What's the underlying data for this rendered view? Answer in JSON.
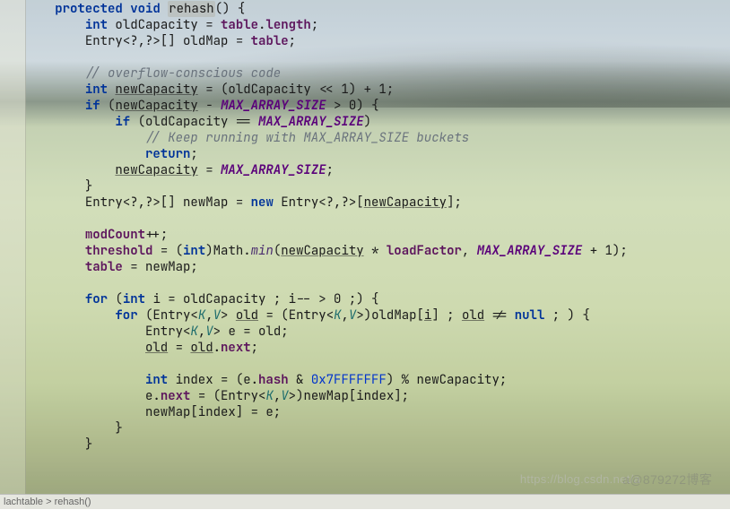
{
  "code": {
    "method_modifier": "protected",
    "method_return": "void",
    "method_name": "rehash",
    "l1_kw_int": "int",
    "l1_var": "oldCapacity",
    "l1_field_table": "table",
    "l1_field_length": "length",
    "l2_type": "Entry",
    "l2_generics": "<?,?>[]",
    "l2_var": "oldMap",
    "l2_assign": "table",
    "c1": "// overflow-conscious code",
    "l3_kw_int": "int",
    "l3_var": "newCapacity",
    "l3_expr_left": "(oldCapacity << 1) + 1",
    "l4_kw_if": "if",
    "l4_cond_left": "newCapacity",
    "l4_minus": "-",
    "l4_const": "MAX_ARRAY_SIZE",
    "l4_cmp": "> 0) {",
    "l5_kw_if": "if",
    "l5_cond": "(oldCapacity ==",
    "l5_const": "MAX_ARRAY_SIZE",
    "l5_close": ")",
    "c2": "// Keep running with MAX_ARRAY_SIZE buckets",
    "l6_kw_return": "return",
    "l7_var": "newCapacity",
    "l7_const": "MAX_ARRAY_SIZE",
    "l8_type": "Entry",
    "l8_gen": "<?,?>[]",
    "l8_var": "newMap",
    "l8_kw_new": "new",
    "l8_ctor": "Entry",
    "l8_ctor_gen": "<?,?>",
    "l8_dim_var": "newCapacity",
    "l9_field": "modCount",
    "l9_op": "++",
    "l10_field": "threshold",
    "l10_cast": "(",
    "l10_cast_type": "int",
    "l10_cast_close": ")",
    "l10_class": "Math",
    "l10_method": "min",
    "l10_arg1": "newCapacity",
    "l10_mul": "*",
    "l10_arg2": "loadFactor",
    "l10_const": "MAX_ARRAY_SIZE",
    "l10_plus1": "+ 1)",
    "l11_field": "table",
    "l11_var": "newMap",
    "l12_kw_for": "for",
    "l12_kw_int": "int",
    "l12_var": "i",
    "l12_init": "= oldCapacity ; i-- > 0 ;) {",
    "l13_kw_for": "for",
    "l13_type": "Entry",
    "l13_gen_o": "<",
    "l13_K": "K",
    "l13_comma": ",",
    "l13_V": "V",
    "l13_gen_c": ">",
    "l13_var_old": "old",
    "l13_eq": "=",
    "l13_cast_o": "(",
    "l13_cast_type": "Entry",
    "l13_cast_close": ")oldMap[",
    "l13_i": "i",
    "l13_after": "] ;",
    "l13_cond_var": "old",
    "l13_cond_rest": " != ",
    "l13_null": "null",
    "l13_tail": " ; ) {",
    "l14_type": "Entry",
    "l14_var_e": "e",
    "l14_assign": "= old;",
    "l15_old": "old",
    "l15_eq": "=",
    "l15_old2": "old",
    "l15_dot": ".",
    "l15_next": "next",
    "l16_kw_int": "int",
    "l16_var": "index",
    "l16_eq": "= (e.",
    "l16_hash": "hash",
    "l16_and": "&",
    "l16_hex": "0x7FFFFFFF",
    "l16_mod": ") % newCapacity;",
    "l17_e": "e",
    "l17_dot": ".",
    "l17_next": "next",
    "l17_eq": " = (",
    "l17_cast": "Entry",
    "l17_after": ")newMap[index];",
    "l18": "newMap[index] = e;"
  },
  "status": {
    "text": "lachtable  >  rehash()"
  },
  "watermark": {
    "url": "https://blog.csdn.net/a",
    "cn": "a@879272博客"
  }
}
